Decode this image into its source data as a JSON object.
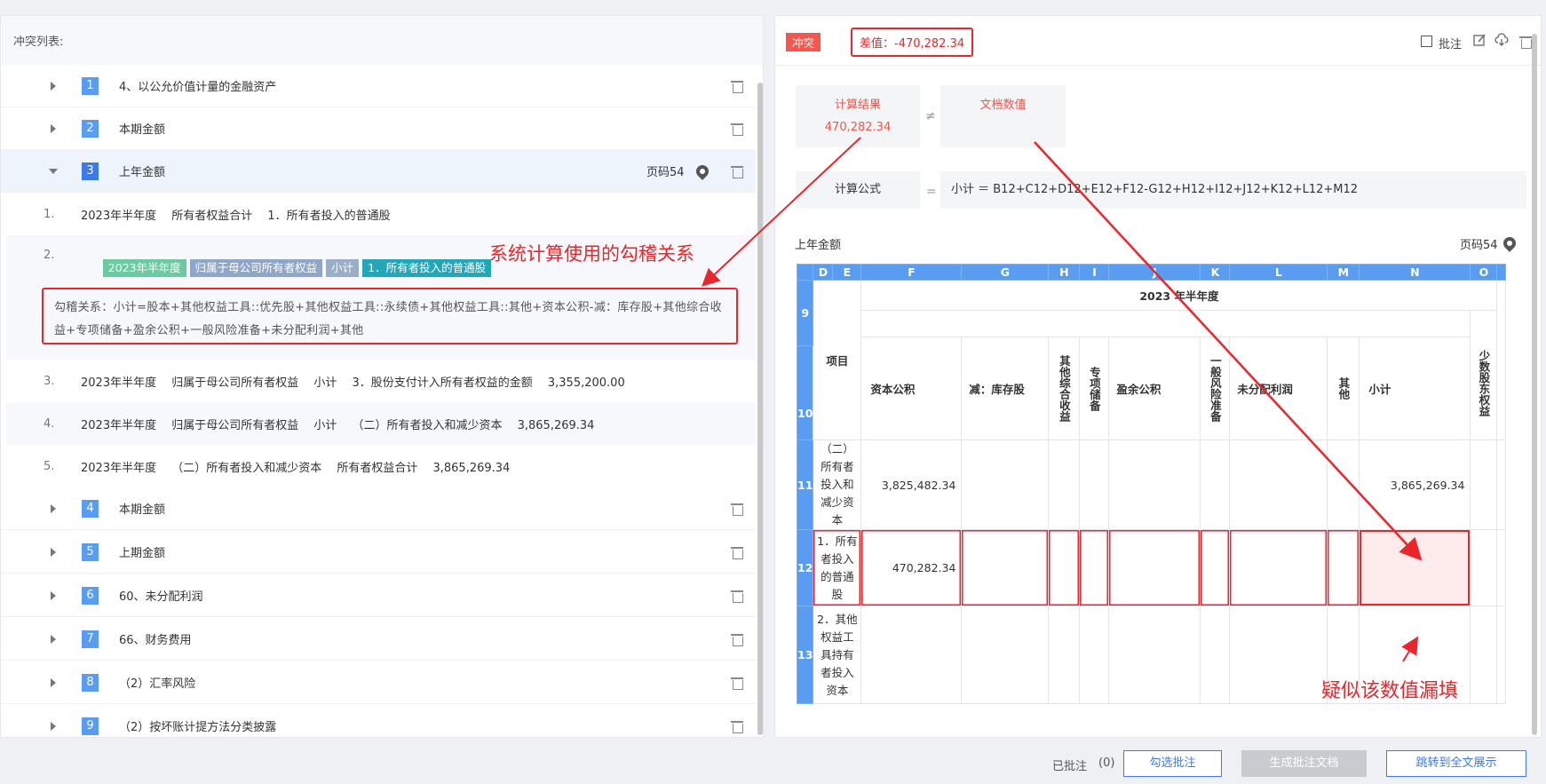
{
  "left_panel": {
    "title": "冲突列表:",
    "rows": [
      {
        "num": "1",
        "label": "4、以公允价值计量的金融资产"
      },
      {
        "num": "2",
        "label": "本期金额"
      },
      {
        "num": "3",
        "label": "上年金额",
        "page": "页码54"
      },
      {
        "num": "4",
        "label": "本期金额"
      },
      {
        "num": "5",
        "label": "上期金额"
      },
      {
        "num": "6",
        "label": "60、未分配利润"
      },
      {
        "num": "7",
        "label": "66、财务费用"
      },
      {
        "num": "8",
        "label": "（2）汇率风险"
      },
      {
        "num": "9",
        "label": "（2）按坏账计提方法分类披露"
      }
    ],
    "subitems": [
      {
        "idx": "1.",
        "text": "2023年半年度　 所有者权益合计　 1．所有者投入的普通股"
      },
      {
        "idx": "2.",
        "tags": [
          "2023年半年度",
          "归属于母公司所有者权益",
          "小计",
          "1．所有者投入的普通股"
        ]
      },
      {
        "idx": "3.",
        "text": "2023年半年度　 归属于母公司所有者权益　 小计　 3．股份支付计入所有者权益的金额　 3,355,200.00"
      },
      {
        "idx": "4.",
        "text": "2023年半年度　 归属于母公司所有者权益　 小计　 （二）所有者投入和减少资本　 3,865,269.34"
      },
      {
        "idx": "5.",
        "text": "2023年半年度　 （二）所有者投入和减少资本　 所有者权益合计　 3,865,269.34"
      }
    ],
    "relation": "勾稽关系：小计=股本+其他权益工具::优先股+其他权益工具::永续债+其他权益工具::其他+资本公积-减：库存股+其他综合收益+专项储备+盈余公积+一般风险准备+未分配利润+其他",
    "annotation": "系统计算使用的勾稽关系"
  },
  "right_panel": {
    "badge": "冲突",
    "diff": "差值：-470,282.34",
    "toolbar": {
      "annotate": "批注"
    },
    "calc_result_label": "计算结果",
    "calc_result_value": "470,282.34",
    "neq": "≠",
    "doc_value_label": "文档数值",
    "formula_label": "计算公式",
    "eq": "=",
    "formula": "小计 ＝ B12+C12+D12+E12+F12-G12+H12+I12+J12+K12+L12+M12",
    "section": "上年金额",
    "page": "页码54",
    "annotation": "疑似该数值漏填",
    "table": {
      "cols": [
        "D",
        "E",
        "F",
        "G",
        "H",
        "I",
        "J",
        "K",
        "L",
        "M",
        "N",
        "O"
      ],
      "period": "2023 年半年度",
      "item_header": "项目",
      "headers": {
        "F": "资本公积",
        "G": "减：库存股",
        "H": "其他综合收益",
        "I": "专项储备",
        "J": "盈余公积",
        "K": "一般风险准备",
        "L": "未分配利润",
        "M": "其他",
        "N": "小计",
        "O": "少数股东权益"
      },
      "rows": [
        {
          "num": "11",
          "item": "（二）所有者投入和减少资本",
          "F": "3,825,482.34",
          "N": "3,865,269.34"
        },
        {
          "num": "12",
          "item": "1．所有者投入的普通股",
          "F": "470,282.34",
          "N": ""
        },
        {
          "num": "13",
          "item": "2．其他权益工具持有者投入资本",
          "F": "",
          "N": ""
        }
      ],
      "row_nums": {
        "r9": "9",
        "r10": "10"
      }
    }
  },
  "footer": {
    "annotated_label": "已批注",
    "annotated_count": "(0)",
    "btn_select": "勾选批注",
    "btn_generate": "生成批注文档",
    "btn_jump": "跳转到全文展示"
  }
}
